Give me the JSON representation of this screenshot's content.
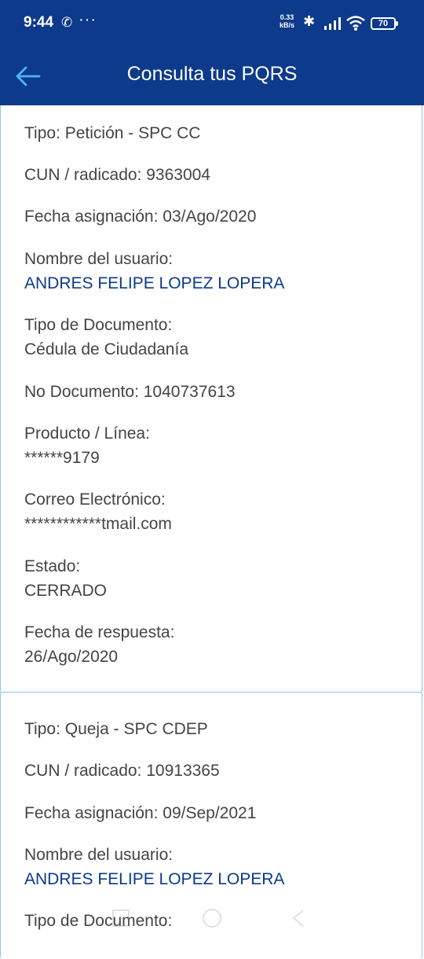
{
  "status": {
    "time": "9:44",
    "speed_top": "0.33",
    "speed_bottom": "kB/s",
    "battery": "70"
  },
  "header": {
    "title": "Consulta tus PQRS"
  },
  "cards": [
    {
      "tipo": "Tipo: Petición - SPC CC",
      "cun": "CUN / radicado: 9363004",
      "fecha_asignacion": "Fecha asignación: 03/Ago/2020",
      "nombre_label": "Nombre del usuario:",
      "nombre": "ANDRES FELIPE LOPEZ LOPERA",
      "tipo_doc_label": "Tipo de Documento:",
      "tipo_doc": "Cédula de Ciudadanía",
      "no_doc": "No Documento: 1040737613",
      "producto_label": "Producto / Línea:",
      "producto": "******9179",
      "correo_label": "Correo Electrónico:",
      "correo": "************tmail.com",
      "estado_label": "Estado:",
      "estado": "CERRADO",
      "fecha_respuesta_label": "Fecha de respuesta:",
      "fecha_respuesta": "26/Ago/2020"
    },
    {
      "tipo": "Tipo: Queja - SPC CDEP",
      "cun": "CUN / radicado: 10913365",
      "fecha_asignacion": "Fecha asignación: 09/Sep/2021",
      "nombre_label": "Nombre del usuario:",
      "nombre": "ANDRES FELIPE LOPEZ LOPERA",
      "tipo_doc_label": "Tipo de Documento:"
    }
  ]
}
